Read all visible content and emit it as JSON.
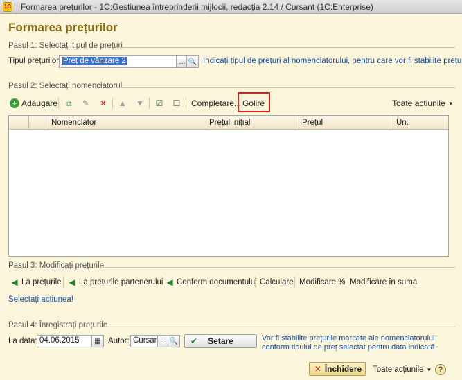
{
  "window": {
    "title": "Formarea prețurilor - 1C:Gestiunea întreprinderii mijlocii, redacția 2.14 / Cursant  (1C:Enterprise)",
    "logo": "1C"
  },
  "heading": "Formarea prețurilor",
  "step1": {
    "label": "Pasul 1: Selectați tipul de prețuri",
    "field_label": "Tipul prețurilor:",
    "value": "Preț de vânzare 2",
    "hint": "Indicați tipul de prețuri al nomenclatorului, pentru care vor fi stabilite prețurile"
  },
  "step2": {
    "label": "Pasul 2: Selectați nomenclatorul",
    "toolbar": {
      "add": "Adăugare",
      "fill": "Completare...",
      "clear": "Golire",
      "all_actions": "Toate acțiunile"
    },
    "columns": [
      "Nomenclator",
      "Prețul inițial",
      "Prețul",
      "Un."
    ]
  },
  "step3": {
    "label": "Pasul 3: Modificați prețurile",
    "actions": {
      "to_prices": "La prețurile",
      "to_partner_prices": "La prețurile partenerului",
      "by_document": "Conform documentului",
      "calculate": "Calculare",
      "modify_percent": "Modificare %",
      "modify_sum": "Modificare în suma"
    },
    "select_action": "Selectați acțiunea!"
  },
  "step4": {
    "label": "Pasul 4: Înregistrați prețurile",
    "date_label": "La data:",
    "date_value": "04.06.2015",
    "author_label": "Autor:",
    "author_value": "Cursant",
    "set_button": "Setare",
    "hint": "Vor fi stabilite prețurile marcate ale nomenclatorului conform tipului de preț selectat pentru data indicată"
  },
  "footer": {
    "close": "Închidere",
    "all_actions": "Toate acțiunile",
    "help": "?"
  }
}
